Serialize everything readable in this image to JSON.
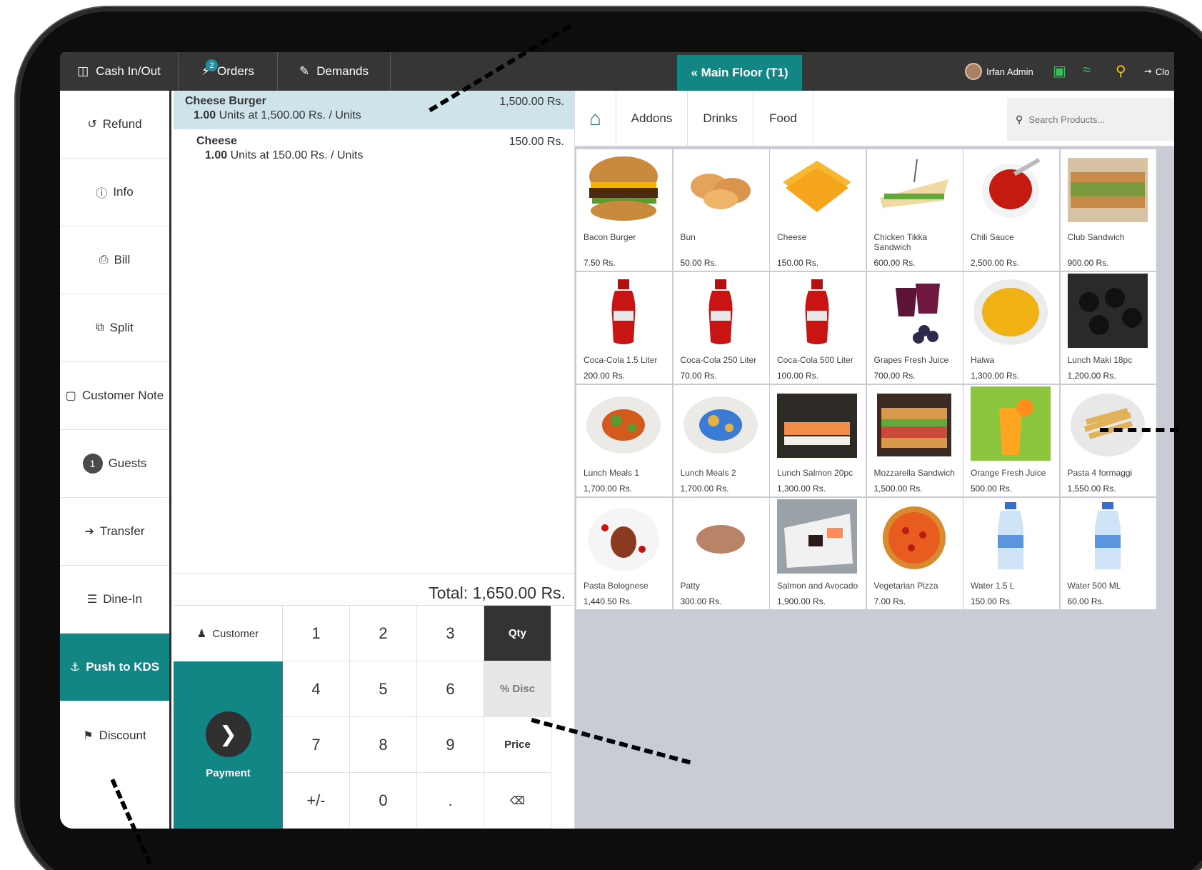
{
  "topbar": {
    "cash_label": "Cash In/Out",
    "orders_label": "Orders",
    "orders_badge": "2",
    "demands_label": "Demands",
    "floor_label": "« Main Floor (T1)",
    "user_name": "Irfan Admin",
    "close_label": "Clo"
  },
  "actions": {
    "refund": "Refund",
    "info": "Info",
    "bill": "Bill",
    "split": "Split",
    "customer_note": "Customer Note",
    "guests_count": "1",
    "guests": "Guests",
    "transfer": "Transfer",
    "dine_in": "Dine-In",
    "push_kds": "Push to KDS",
    "discount": "Discount"
  },
  "order": {
    "lines": [
      {
        "name": "Cheese Burger",
        "qty": "1.00",
        "detail": "Units at 1,500.00 Rs. / Units",
        "price": "1,500.00 Rs."
      },
      {
        "name": "Cheese",
        "qty": "1.00",
        "detail": "Units at 150.00 Rs. / Units",
        "price": "150.00 Rs."
      }
    ],
    "total": "Total: 1,650.00 Rs."
  },
  "keypad": {
    "customer": "Customer",
    "payment": "Payment",
    "keys": [
      "1",
      "2",
      "3",
      "Qty",
      "4",
      "5",
      "6",
      "% Disc",
      "7",
      "8",
      "9",
      "Price",
      "+/-",
      "0",
      ".",
      "⌫"
    ]
  },
  "categories": {
    "addons": "Addons",
    "drinks": "Drinks",
    "food": "Food",
    "search_placeholder": "Search Products..."
  },
  "products": [
    {
      "name": "Bacon Burger",
      "price": "7.50 Rs."
    },
    {
      "name": "Bun",
      "price": "50.00 Rs."
    },
    {
      "name": "Cheese",
      "price": "150.00 Rs."
    },
    {
      "name": "Chicken Tikka Sandwich",
      "price": "600.00 Rs."
    },
    {
      "name": "Chili Sauce",
      "price": "2,500.00 Rs."
    },
    {
      "name": "Club Sandwich",
      "price": "900.00 Rs."
    },
    {
      "name": "Coca-Cola 1.5 Liter",
      "price": "200.00 Rs."
    },
    {
      "name": "Coca-Cola 250 Liter",
      "price": "70.00 Rs."
    },
    {
      "name": "Coca-Cola 500 Liter",
      "price": "100.00 Rs."
    },
    {
      "name": "Grapes Fresh Juice",
      "price": "700.00 Rs."
    },
    {
      "name": "Halwa",
      "price": "1,300.00 Rs."
    },
    {
      "name": "Lunch Maki 18pc",
      "price": "1,200.00 Rs."
    },
    {
      "name": "Lunch Meals 1",
      "price": "1,700.00 Rs."
    },
    {
      "name": "Lunch Meals 2",
      "price": "1,700.00 Rs."
    },
    {
      "name": "Lunch Salmon 20pc",
      "price": "1,300.00 Rs."
    },
    {
      "name": "Mozzarella Sandwich",
      "price": "1,500.00 Rs."
    },
    {
      "name": "Orange Fresh Juice",
      "price": "500.00 Rs."
    },
    {
      "name": "Pasta 4 formaggi",
      "price": "1,550.00 Rs."
    },
    {
      "name": "Pasta Bolognese",
      "price": "1,440.50 Rs."
    },
    {
      "name": "Patty",
      "price": "300.00 Rs."
    },
    {
      "name": "Salmon and Avocado",
      "price": "1,900.00 Rs."
    },
    {
      "name": "Vegetarian Pizza",
      "price": "7.00 Rs."
    },
    {
      "name": "Water 1.5 L",
      "price": "150.00 Rs."
    },
    {
      "name": "Water 500 ML",
      "price": "60.00 Rs."
    }
  ],
  "colors": {
    "accent": "#128585",
    "topbar": "#363636",
    "status_green": "#35c35a"
  }
}
